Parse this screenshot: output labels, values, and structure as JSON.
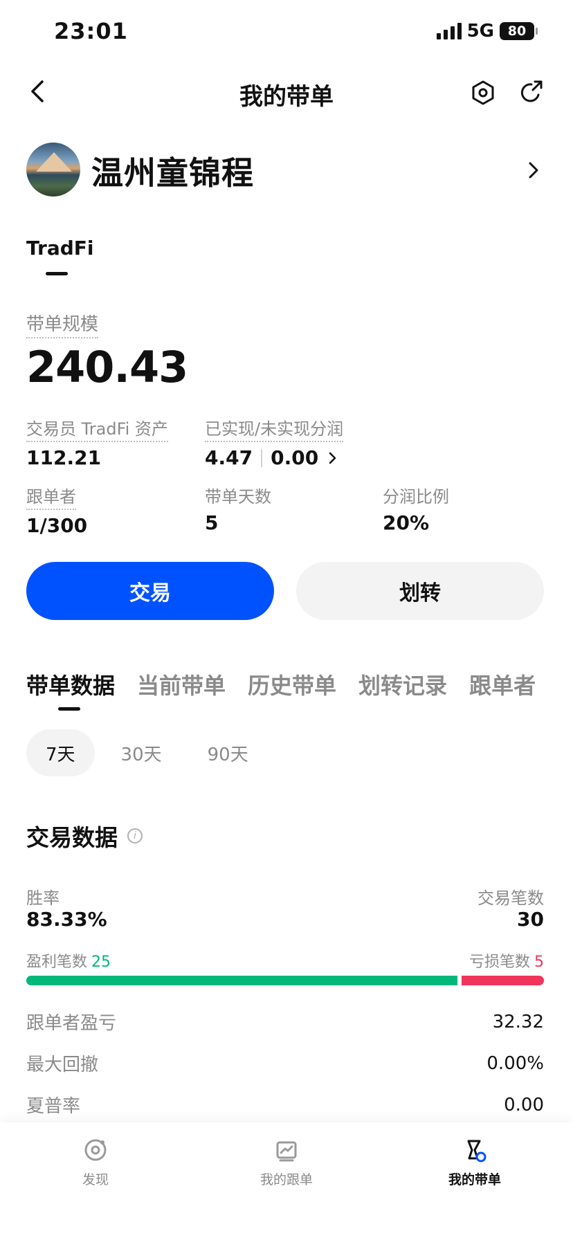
{
  "status_bar": {
    "time": "23:01",
    "network": "5G",
    "battery": "80"
  },
  "nav": {
    "title": "我的带单"
  },
  "profile": {
    "name": "温州童锦程"
  },
  "section_tab": "TradFi",
  "scale": {
    "label": "带单规模",
    "value": "240.43"
  },
  "stats": {
    "trader_assets": {
      "label": "交易员 TradFi 资产",
      "value": "112.21"
    },
    "profit_share": {
      "label": "已实现/未实现分润",
      "realized": "4.47",
      "unrealized": "0.00"
    },
    "followers": {
      "label": "跟单者",
      "value": "1/300"
    },
    "days": {
      "label": "带单天数",
      "value": "5"
    },
    "ratio": {
      "label": "分润比例",
      "value": "20%"
    }
  },
  "buttons": {
    "trade": "交易",
    "transfer": "划转"
  },
  "data_tabs": [
    "带单数据",
    "当前带单",
    "历史带单",
    "划转记录",
    "跟单者"
  ],
  "periods": [
    "7天",
    "30天",
    "90天"
  ],
  "trade_data": {
    "title": "交易数据",
    "win_rate_label": "胜率",
    "win_rate": "83.33%",
    "trade_count_label": "交易笔数",
    "trade_count": "30",
    "profit_count_label": "盈利笔数",
    "profit_count": "25",
    "loss_count_label": "亏损笔数",
    "loss_count": "5",
    "profit_ratio": 0.8333,
    "colors": {
      "profit": "#00b87a",
      "loss": "#f0355a",
      "primary": "#0052ff"
    },
    "metrics": [
      {
        "label": "跟单者盈亏",
        "value": "32.32"
      },
      {
        "label": "最大回撤",
        "value": "0.00%"
      },
      {
        "label": "夏普率",
        "value": "0.00"
      }
    ]
  },
  "bottom_nav": [
    {
      "label": "发现",
      "icon": "discover-icon"
    },
    {
      "label": "我的跟单",
      "icon": "chart-icon"
    },
    {
      "label": "我的带单",
      "icon": "lead-trade-icon"
    }
  ]
}
